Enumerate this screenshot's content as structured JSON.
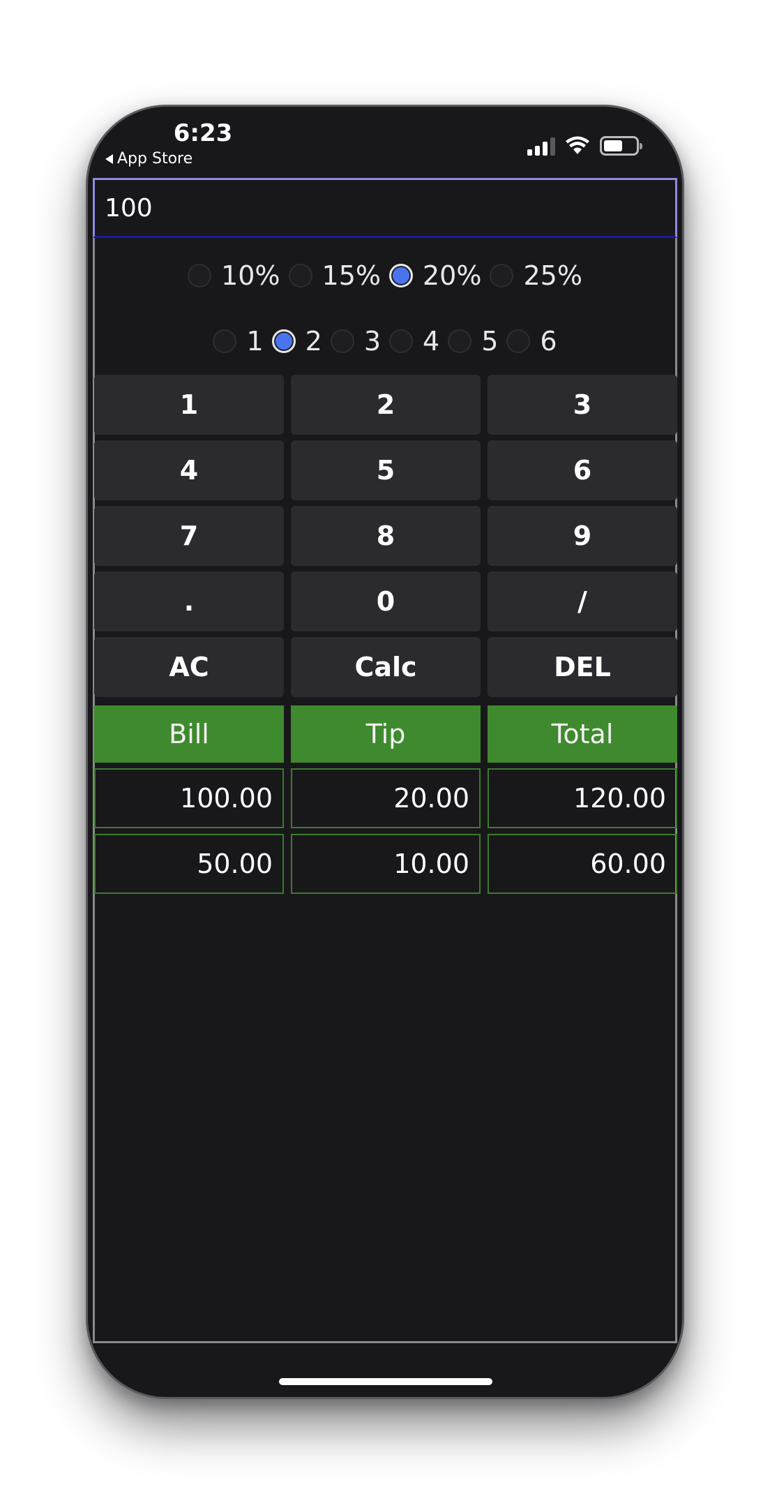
{
  "status_bar": {
    "time": "6:23",
    "back_label": "App Store"
  },
  "bill_input": {
    "value": "100"
  },
  "tip_options": [
    {
      "label": "10%",
      "checked": false
    },
    {
      "label": "15%",
      "checked": false
    },
    {
      "label": "20%",
      "checked": true
    },
    {
      "label": "25%",
      "checked": false
    }
  ],
  "split_options": [
    {
      "label": "1",
      "checked": false
    },
    {
      "label": "2",
      "checked": true
    },
    {
      "label": "3",
      "checked": false
    },
    {
      "label": "4",
      "checked": false
    },
    {
      "label": "5",
      "checked": false
    },
    {
      "label": "6",
      "checked": false
    }
  ],
  "keypad": [
    {
      "label": "1",
      "name": "key-1"
    },
    {
      "label": "2",
      "name": "key-2"
    },
    {
      "label": "3",
      "name": "key-3"
    },
    {
      "label": "4",
      "name": "key-4"
    },
    {
      "label": "5",
      "name": "key-5"
    },
    {
      "label": "6",
      "name": "key-6"
    },
    {
      "label": "7",
      "name": "key-7"
    },
    {
      "label": "8",
      "name": "key-8"
    },
    {
      "label": "9",
      "name": "key-9"
    },
    {
      "label": ".",
      "name": "key-decimal"
    },
    {
      "label": "0",
      "name": "key-0"
    },
    {
      "label": "/",
      "name": "key-divide"
    },
    {
      "label": "AC",
      "name": "all-clear-button"
    },
    {
      "label": "Calc",
      "name": "calc-button"
    },
    {
      "label": "DEL",
      "name": "delete-button"
    }
  ],
  "results": {
    "headers": [
      "Bill",
      "Tip",
      "Total"
    ],
    "rows": [
      [
        "100.00",
        "20.00",
        "120.00"
      ],
      [
        "50.00",
        "10.00",
        "60.00"
      ]
    ]
  },
  "colors": {
    "background": "#18181b",
    "key": "#2a2a2f",
    "header_green": "#3f8a2e",
    "radio_selected": "#4a74ee",
    "input_border": "#8c8ce0"
  }
}
